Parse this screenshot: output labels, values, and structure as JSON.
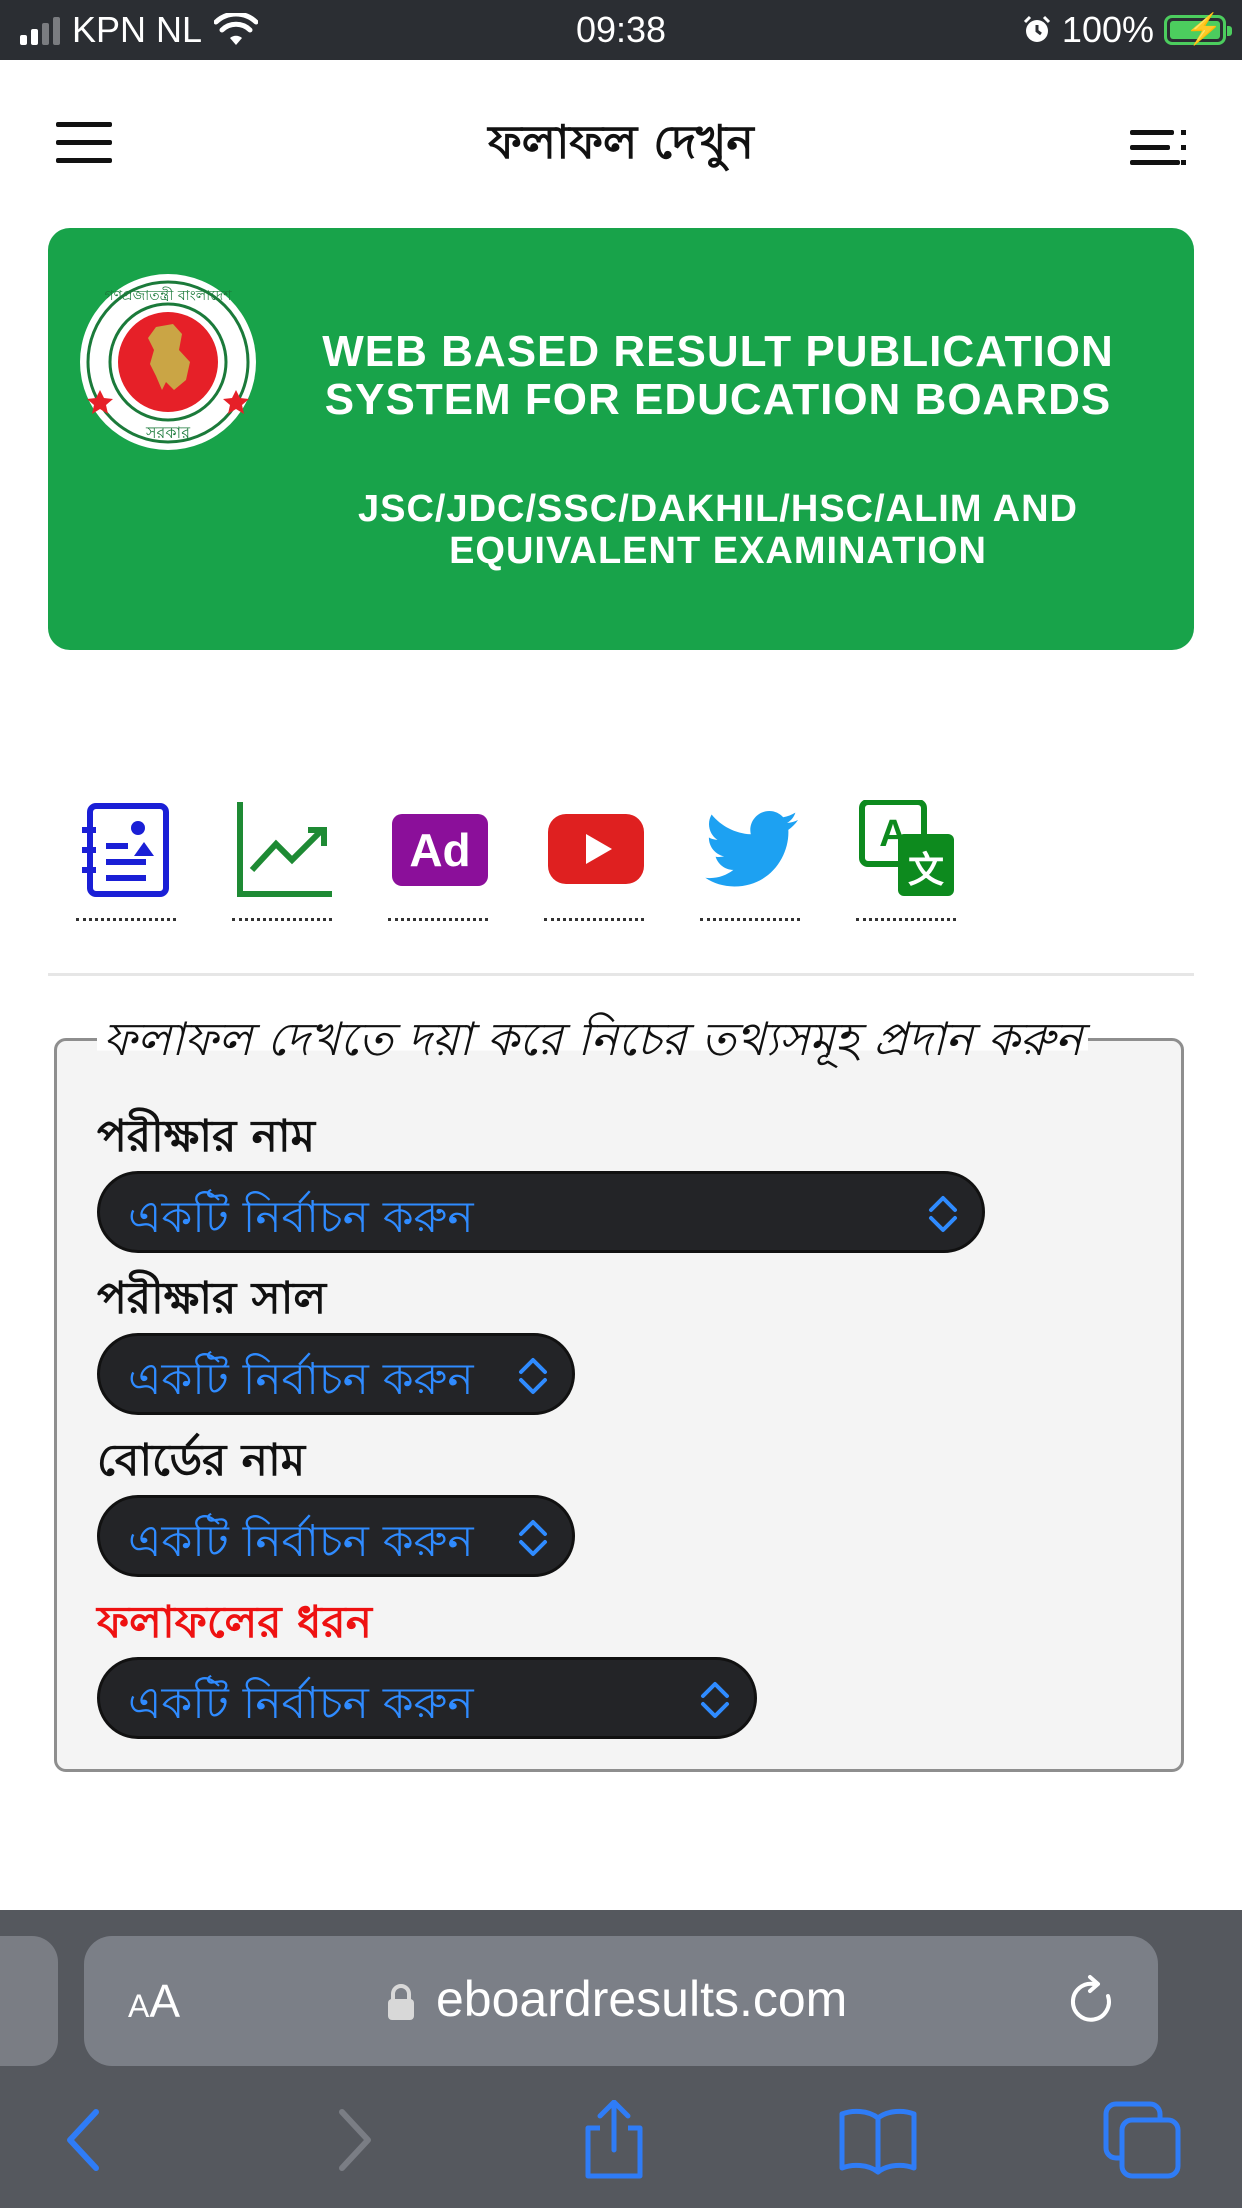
{
  "status_bar": {
    "carrier": "KPN NL",
    "time": "09:38",
    "battery": "100%"
  },
  "header": {
    "title": "ফলাফল দেখুন"
  },
  "banner": {
    "title_line1": "WEB BASED RESULT PUBLICATION",
    "title_line2": "SYSTEM FOR EDUCATION BOARDS",
    "sub_line1": "JSC/JDC/SSC/DAKHIL/HSC/ALIM AND",
    "sub_line2": "EQUIVALENT EXAMINATION",
    "seal_text_top": "গণপ্রজাতন্ত্রী বাংলাদেশ",
    "seal_text_bottom": "সরকার"
  },
  "icons": {
    "ad_label": "Ad",
    "translate_label_a": "A",
    "translate_label_b": "文"
  },
  "form": {
    "legend": "ফলাফল দেখতে দয়া করে নিচের তথ্যসমূহ প্রদান করুন",
    "fields": [
      {
        "label": "পরীক্ষার নাম",
        "value": "একটি নির্বাচন করুন"
      },
      {
        "label": "পরীক্ষার সাল",
        "value": "একটি নির্বাচন করুন"
      },
      {
        "label": "বোর্ডের নাম",
        "value": "একটি নির্বাচন করুন"
      },
      {
        "label": "ফলাফলের ধরন",
        "value": "একটি নির্বাচন করুন"
      }
    ]
  },
  "browser": {
    "aa_big": "A",
    "aa_small": "A",
    "url": "eboardresults.com"
  },
  "colors": {
    "banner_green": "#18a34a",
    "select_text_blue": "#2f8bff",
    "red_label": "#ee1111",
    "safari_blue": "#2f7cf6"
  }
}
